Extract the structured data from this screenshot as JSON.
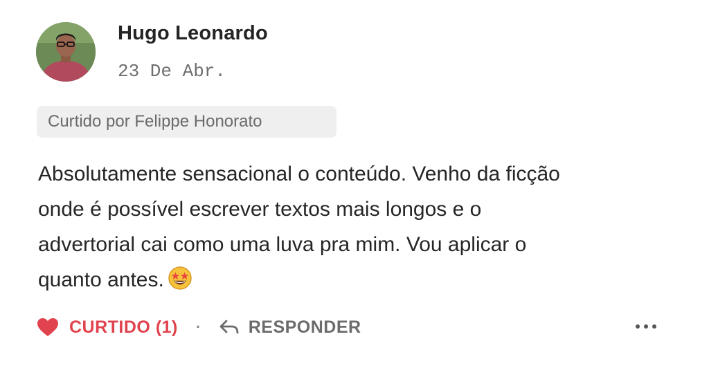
{
  "comment": {
    "author": "Hugo Leonardo",
    "date": "23 De Abr.",
    "liked_by": "Curtido por Felippe Honorato",
    "body_lines": [
      "Absolutamente sensacional o conteúdo. Venho da ficção",
      "onde é possível escrever textos mais longos e o",
      "advertorial cai como uma luva pra mim. Vou aplicar o",
      "quanto antes."
    ],
    "emoji": "star-struck-emoji"
  },
  "actions": {
    "like_label": "CURTIDO (1)",
    "separator": "·",
    "reply_label": "RESPONDER",
    "more_icon": "ellipsis-icon"
  },
  "colors": {
    "like_red": "#e1434e",
    "badge_bg": "#efefef",
    "muted_text": "#6b6b6b"
  }
}
